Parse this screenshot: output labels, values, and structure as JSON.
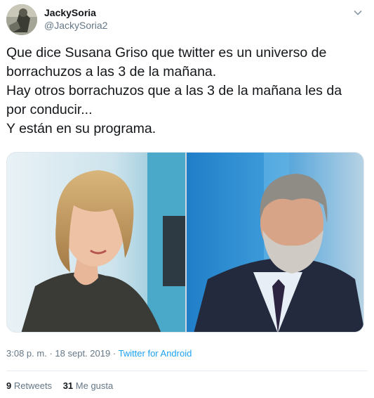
{
  "tweet": {
    "display_name": "JackySoria",
    "handle": "@JackySoria2",
    "text_lines": [
      "Que dice Susana Griso que twitter es un universo de",
      "borrachuzos a las 3 de la mañana.",
      "Hay otros borrachuzos que a las 3 de la mañana les da",
      "por conducir...",
      "Y están en su programa."
    ],
    "time": "3:08 p. m.",
    "separator": "·",
    "date": "18 sept. 2019",
    "source": "Twitter for Android",
    "retweets_count": "9",
    "retweets_label": "Retweets",
    "likes_count": "31",
    "likes_label": "Me gusta"
  },
  "icons": {
    "menu": "chevron-down-icon",
    "avatar": "avatar-photo"
  },
  "colors": {
    "text": "#14171a",
    "secondary": "#657786",
    "link": "#1da1f2",
    "divider": "#e6ecf0"
  }
}
